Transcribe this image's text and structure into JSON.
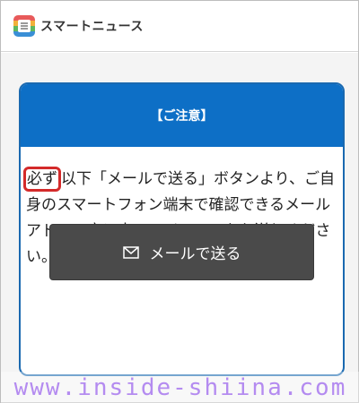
{
  "app": {
    "title": "スマートニュース",
    "logo_icon": "smartnews-logo-icon"
  },
  "notice": {
    "heading": "【ご注意】",
    "highlight_word": "必ず",
    "body_text": "以下「メールで送る」ボタンより、ご自身のスマートフォン端末で確認できるメールアドレス宛に本ページのURLをお送りください。",
    "button_label": "メールで送る",
    "button_icon": "mail-icon"
  },
  "watermark": "www.inside-shiina.com",
  "colors": {
    "header_blue": "#0d6fc6",
    "card_border": "#1a69b0",
    "button_bg": "#4a4a4a",
    "highlight_red": "#d42a2a",
    "watermark": "#b48bf0"
  }
}
